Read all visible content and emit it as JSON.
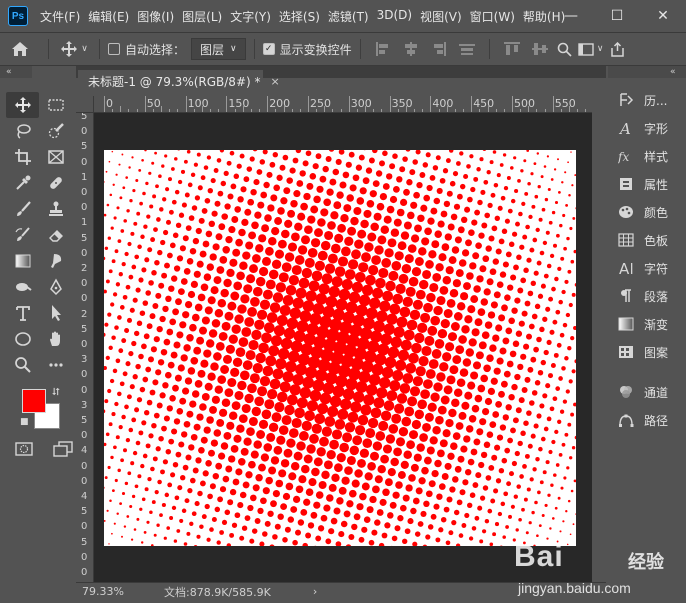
{
  "app": {
    "logo_text": "Ps"
  },
  "menu": [
    "文件(F)",
    "编辑(E)",
    "图像(I)",
    "图层(L)",
    "文字(Y)",
    "选择(S)",
    "滤镜(T)",
    "3D(D)",
    "视图(V)",
    "窗口(W)",
    "帮助(H)"
  ],
  "window_controls": {
    "minimize": "—",
    "maximize": "☐",
    "close": "✕"
  },
  "options_bar": {
    "auto_select_label": "自动选择：",
    "auto_select_checked": false,
    "layer_select_value": "图层",
    "show_transform_label": "显示变换控件",
    "show_transform_checked": true
  },
  "panel_collapse": {
    "left": "«",
    "right": "«"
  },
  "document": {
    "tab_title": "未标题-1 @ 79.3%(RGB/8#) *",
    "close_glyph": "×",
    "zoom": "79.33%",
    "doc_size": "文档:878.9K/585.9K",
    "status_arrow": "›"
  },
  "ruler_h_labels": [
    "0",
    "50",
    "100",
    "150",
    "200",
    "250",
    "300",
    "350",
    "400",
    "450",
    "500",
    "550",
    "60"
  ],
  "ruler_v_labels": [
    "5",
    "0",
    "5",
    "0",
    "1",
    "0",
    "0",
    "1",
    "5",
    "0",
    "2",
    "0",
    "0",
    "2",
    "5",
    "0",
    "3",
    "0",
    "0",
    "3",
    "5",
    "0",
    "4",
    "0",
    "0",
    "4",
    "5",
    "0",
    "5",
    "0",
    "0"
  ],
  "colors": {
    "foreground": "#ff0000",
    "background": "#ffffff",
    "accent": "#31a8ff"
  },
  "halftone": {
    "dot_color": "#ff0000",
    "angle_deg": 16
  },
  "right_panels": [
    {
      "icon": "history-icon",
      "label": "历..."
    },
    {
      "icon": "glyphs-icon",
      "label": "字形"
    },
    {
      "icon": "styles-icon",
      "label": "样式"
    },
    {
      "icon": "properties-icon",
      "label": "属性"
    },
    {
      "icon": "color-icon",
      "label": "颜色"
    },
    {
      "icon": "swatches-icon",
      "label": "色板"
    },
    {
      "icon": "character-icon",
      "label": "字符"
    },
    {
      "icon": "paragraph-icon",
      "label": "段落"
    },
    {
      "icon": "gradient-icon",
      "label": "渐变"
    },
    {
      "icon": "patterns-icon",
      "label": "图案"
    },
    {
      "icon": "channels-icon",
      "label": "通道"
    },
    {
      "icon": "paths-icon",
      "label": "路径"
    }
  ],
  "watermark": {
    "logo": "Bai",
    "brand": "经验",
    "url": "jingyan.baidu.com"
  }
}
